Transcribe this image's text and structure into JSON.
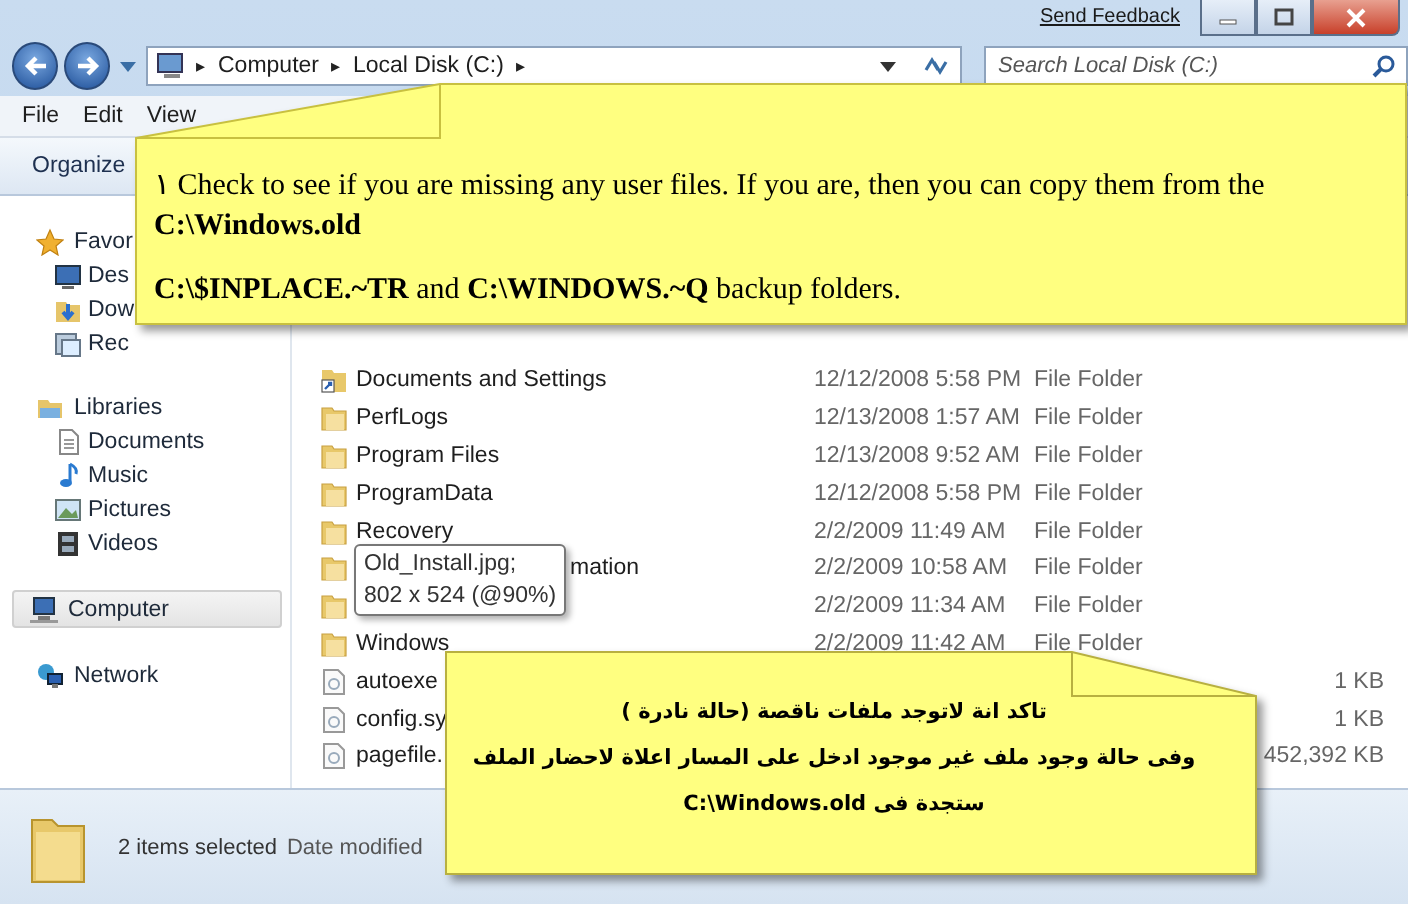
{
  "window": {
    "send_feedback": "Send Feedback"
  },
  "address_bar": {
    "crumbs": [
      {
        "kind": "chevron",
        "text": "▸"
      },
      {
        "kind": "crumb",
        "text": "Computer"
      },
      {
        "kind": "chevron",
        "text": "▸"
      },
      {
        "kind": "crumb",
        "text": "Local Disk (C:)"
      },
      {
        "kind": "chevron",
        "text": "▸"
      }
    ]
  },
  "search": {
    "placeholder": "Search Local Disk (C:)"
  },
  "menu": [
    "File",
    "Edit",
    "View"
  ],
  "toolbar": {
    "organize": "Organize"
  },
  "sidebar": [
    {
      "label": "Favor",
      "kind": "star",
      "selected": false,
      "children": [
        {
          "label": "Des",
          "kind": "desktop",
          "selected": false
        },
        {
          "label": "Dow",
          "kind": "download",
          "selected": false
        },
        {
          "label": "Rec",
          "kind": "recent",
          "selected": false
        }
      ]
    },
    {
      "label": "Libraries",
      "kind": "library",
      "selected": false,
      "children": [
        {
          "label": "Documents",
          "kind": "document",
          "selected": false
        },
        {
          "label": "Music",
          "kind": "music",
          "selected": false
        },
        {
          "label": "Pictures",
          "kind": "picture",
          "selected": false
        },
        {
          "label": "Videos",
          "kind": "video",
          "selected": false
        }
      ]
    },
    {
      "label": "Computer",
      "kind": "computer",
      "selected": true
    },
    {
      "label": "Network",
      "kind": "network",
      "selected": false
    }
  ],
  "rows": [
    {
      "kind": "shortcut",
      "name": "Documents and Settings",
      "date": "12/12/2008 5:58 PM",
      "type": "File Folder"
    },
    {
      "kind": "folder",
      "name": "PerfLogs",
      "date": "12/13/2008 1:57 AM",
      "type": "File Folder"
    },
    {
      "kind": "folder",
      "name": "Program Files",
      "date": "12/13/2008 9:52 AM",
      "type": "File Folder"
    },
    {
      "kind": "folder",
      "name": "ProgramData",
      "date": "12/12/2008 5:58 PM",
      "type": "File Folder"
    },
    {
      "kind": "folder",
      "name": "Recovery",
      "date": "2/2/2009 11:49 AM",
      "type": "File Folder"
    },
    {
      "kind": "covered",
      "name": "mation",
      "date": "2/2/2009 10:58 AM",
      "type": "File Folder"
    },
    {
      "kind": "folder",
      "date": "2/2/2009 11:34 AM",
      "type": "File Folder"
    },
    {
      "kind": "folder",
      "name": "Windows",
      "date": "2/2/2009 11:42 AM",
      "type": "File Folder"
    },
    {
      "kind": "file",
      "name": "autoexe",
      "size": "1 KB"
    },
    {
      "kind": "file",
      "name": "config.sy",
      "size": "1 KB"
    },
    {
      "kind": "file",
      "name": "pagefile.",
      "size": "452,392 KB"
    }
  ],
  "tooltip": {
    "lines": [
      "Old_Install.jpg;",
      "802 x 524 (@90%)"
    ]
  },
  "status_bar": {
    "selection": "2 items selected",
    "detail": "Date modified"
  },
  "callout_top": {
    "paragraphs": [
      "١ Check to see if you are missing any user files. If you are, then you can copy them from the **C:\\Windows.old**",
      "**C:\\$INPLACE.~TR** and **C:\\WINDOWS.~Q** backup folders."
    ]
  },
  "callout_bottom": {
    "lines": [
      "تاكد انة لاتوجد ملفات ناقصة (حالة نادرة )",
      "وفى حالة وجود ملف غير موجود ادخل على المسار اعلاة لاحضار الملف",
      "ستجدة فى    C:\\Windows.old"
    ]
  }
}
